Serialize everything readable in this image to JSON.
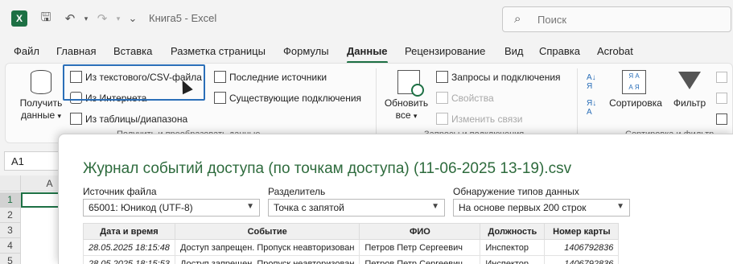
{
  "app": {
    "title": "Книга5  -  Excel",
    "logo": "X"
  },
  "search": {
    "placeholder": "Поиск"
  },
  "menu": {
    "tabs": [
      "Файл",
      "Главная",
      "Вставка",
      "Разметка страницы",
      "Формулы",
      "Данные",
      "Рецензирование",
      "Вид",
      "Справка",
      "Acrobat"
    ],
    "active": "Данные"
  },
  "ribbon": {
    "get_data": {
      "line1": "Получить",
      "line2": "данные"
    },
    "from_text_csv": "Из текстового/CSV-файла",
    "from_web": "Из Интернета",
    "from_table": "Из таблицы/диапазона",
    "recent_sources": "Последние источники",
    "existing_connections": "Существующие подключения",
    "group_get_transform": "Получить и преобразовать данные",
    "refresh_all": {
      "line1": "Обновить",
      "line2": "все"
    },
    "queries_connections": "Запросы и подключения",
    "properties": "Свойства",
    "edit_links": "Изменить связи",
    "group_queries": "Запросы и подключения",
    "sort": "Сортировка",
    "filter": "Фильтр",
    "group_sort_filter": "Сортировка и фильтр"
  },
  "sheet": {
    "name_box": "A1",
    "columns": [
      "A"
    ],
    "rows": [
      "1",
      "2",
      "3",
      "4",
      "5"
    ]
  },
  "dialog": {
    "title": "Журнал событий доступа (по точкам доступа) (11-06-2025 13-19).csv",
    "file_origin_label": "Источник файла",
    "file_origin_value": "65001: Юникод (UTF-8)",
    "delimiter_label": "Разделитель",
    "delimiter_value": "Точка с запятой",
    "type_detection_label": "Обнаружение типов данных",
    "type_detection_value": "На основе первых 200 строк",
    "table": {
      "headers": [
        "Дата и время",
        "Событие",
        "ФИО",
        "Должность",
        "Номер карты"
      ],
      "rows": [
        [
          "28.05.2025 18:15:48",
          "Доступ запрещен. Пропуск неавторизован",
          "Петров Петр Сергеевич",
          "Инспектор",
          "1406792836"
        ],
        [
          "28.05.2025 18:15:53",
          "Доступ запрещен. Пропуск неавторизован",
          "Петров Петр Сергеевич",
          "Инспектор",
          "1406792836"
        ]
      ]
    }
  }
}
